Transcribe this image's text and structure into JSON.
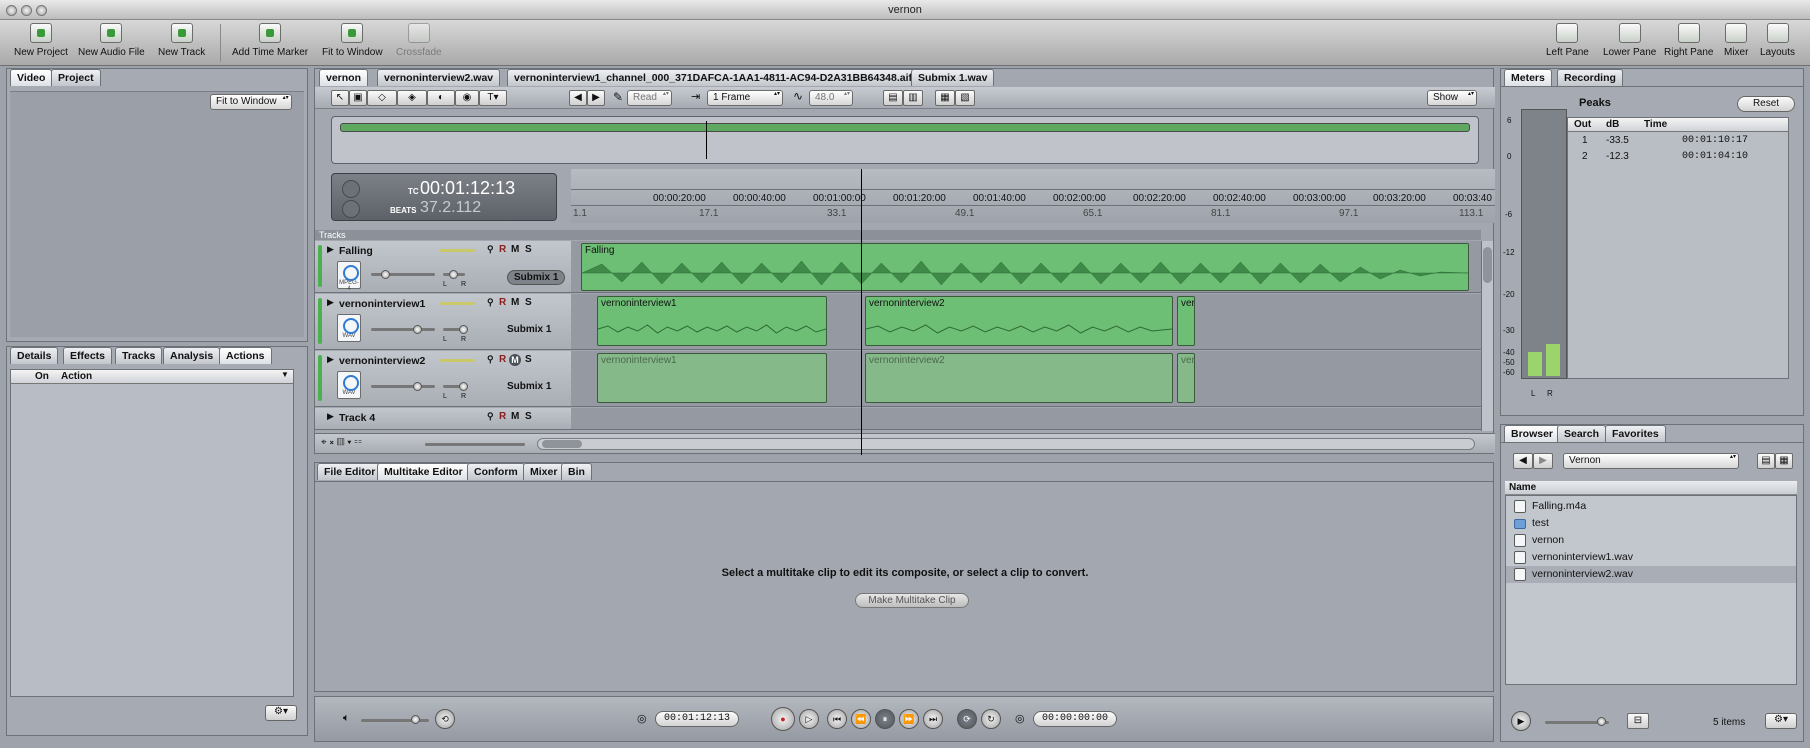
{
  "window": {
    "title": "vernon"
  },
  "toolbar": {
    "left": [
      "New Project",
      "New Audio File",
      "New Track",
      "Add Time Marker",
      "Fit to Window",
      "Crossfade"
    ],
    "right": [
      "Left Pane",
      "Lower Pane",
      "Right Pane",
      "Mixer",
      "Layouts"
    ]
  },
  "left_top": {
    "tabs": [
      "Video",
      "Project"
    ],
    "fit_popup": "Fit to Window"
  },
  "left_bottom": {
    "tabs": [
      "Details",
      "Effects",
      "Tracks",
      "Analysis",
      "Actions"
    ],
    "columns": {
      "on": "On",
      "action": "Action"
    }
  },
  "doc_tabs": [
    "vernon",
    "vernoninterview2.wav",
    "vernoninterview1_channel_000_371DAFCA-1AA1-4811-AC94-D2A31BB64348.aif",
    "Submix 1.wav"
  ],
  "timeline_toolbar": {
    "read": "Read",
    "frame": "1 Frame",
    "value": "48.0",
    "show": "Show"
  },
  "timecode": {
    "tc_label": "TC",
    "tc": "00:01:12:13",
    "beats_label": "BEATS",
    "beats": "37.2.112"
  },
  "ruler": {
    "times": [
      "00:00:20:00",
      "00:00:40:00",
      "00:01:00:00",
      "00:01:20:00",
      "00:01:40:00",
      "00:02:00:00",
      "00:02:20:00",
      "00:02:40:00",
      "00:03:00:00",
      "00:03:20:00",
      "00:03:40"
    ],
    "beats": [
      "1.1",
      "17.1",
      "33.1",
      "49.1",
      "65.1",
      "81.1",
      "97.1",
      "113.1"
    ]
  },
  "tracks_header": "Tracks",
  "tracks": [
    {
      "name": "Falling",
      "icon_label": "MPEG-4",
      "submix": "Submix 1",
      "clips": [
        "Falling"
      ]
    },
    {
      "name": "vernoninterview1",
      "icon_label": "WAV",
      "submix": "Submix 1",
      "clips": [
        "vernoninterview1",
        "vernoninterview2",
        "ver"
      ]
    },
    {
      "name": "vernoninterview2",
      "icon_label": "WAV",
      "submix": "Submix 1",
      "clips": [
        "vernoninterview1",
        "vernoninterview2",
        "ver"
      ]
    },
    {
      "name": "Track 4"
    }
  ],
  "track_buttons": {
    "r": "R",
    "m": "M",
    "s": "S",
    "l": "L",
    "rr": "R"
  },
  "editor": {
    "tabs": [
      "File Editor",
      "Multitake Editor",
      "Conform",
      "Mixer",
      "Bin"
    ],
    "message": "Select a multitake clip to edit its composite, or select a clip to convert.",
    "button": "Make Multitake Clip"
  },
  "transport": {
    "position": "00:01:12:13",
    "duration": "00:00:00:00"
  },
  "meters": {
    "tabs": [
      "Meters",
      "Recording"
    ],
    "peaks_title": "Peaks",
    "reset": "Reset",
    "columns": [
      "Out",
      "dB",
      "Time"
    ],
    "rows": [
      {
        "out": "1",
        "db": "-33.5",
        "time": "00:01:10:17"
      },
      {
        "out": "2",
        "db": "-12.3",
        "time": "00:01:04:10"
      }
    ],
    "scale": [
      "6",
      "0",
      "-6",
      "-12",
      "-20",
      "-30",
      "-40",
      "-50",
      "-60"
    ],
    "channels": [
      "L",
      "R"
    ],
    "levels": [
      0.09,
      0.12
    ]
  },
  "browser": {
    "tabs": [
      "Browser",
      "Search",
      "Favorites"
    ],
    "location": "Vernon",
    "column": "Name",
    "items": [
      {
        "name": "Falling.m4a",
        "type": "audio"
      },
      {
        "name": "test",
        "type": "folder"
      },
      {
        "name": "vernon",
        "type": "project"
      },
      {
        "name": "vernoninterview1.wav",
        "type": "audio"
      },
      {
        "name": "vernoninterview2.wav",
        "type": "audio"
      }
    ],
    "count": "5 items"
  }
}
